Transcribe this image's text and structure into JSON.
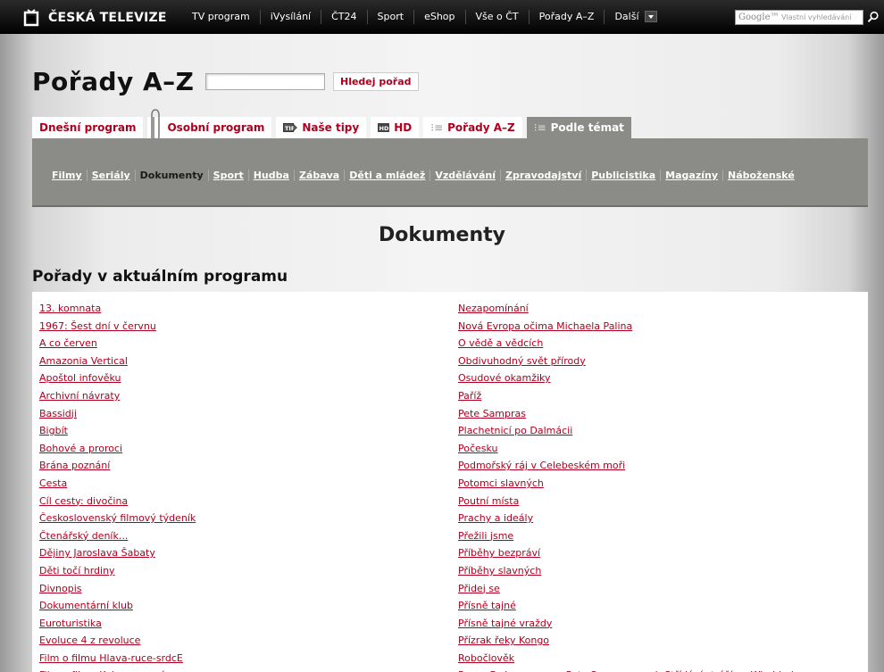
{
  "header": {
    "logo_text": "ČESKÁ TELEVIZE",
    "nav": [
      "TV program",
      "iVysílání",
      "ČT24",
      "Sport",
      "eShop",
      "Vše o ČT",
      "Pořady A–Z",
      "Další"
    ],
    "search_brand": "Google™",
    "search_placeholder": "Vlastní vyhledávání"
  },
  "page": {
    "title": "Pořady A–Z",
    "find_button": "Hledej pořad",
    "tabs": [
      {
        "label": "Dnešní program",
        "icon": ""
      },
      {
        "label": "Osobní program",
        "icon": "paperclip-icon"
      },
      {
        "label": "Naše tipy",
        "icon": "tip-icon"
      },
      {
        "label": "HD",
        "icon": "hd-icon"
      },
      {
        "label": "Pořady A–Z",
        "icon": "list-icon"
      },
      {
        "label": "Podle témat",
        "icon": "list-icon"
      }
    ],
    "subnav": [
      "Filmy",
      "Seriály",
      "Dokumenty",
      "Sport",
      "Hudba",
      "Zábava",
      "Děti a mládež",
      "Vzdělávání",
      "Zpravodajství",
      "Publicistika",
      "Magazíny",
      "Náboženské"
    ],
    "section_title": "Dokumenty",
    "list_heading": "Pořady v aktuálním programu",
    "left_items": [
      "13. komnata",
      "1967: Šest dní v červnu",
      "A co červen",
      "Amazonia Vertical",
      "Apoštol infověku",
      "Archivní návraty",
      "Bassidji",
      "Bigbít",
      "Bohové a proroci",
      "Brána poznání",
      "Cesta",
      "Cíl cesty: divočina",
      "Československý filmový týdeník",
      "Čtenářský deník...",
      "Dějiny Jaroslava Šabaty",
      "Děti točí hrdiny",
      "Divnopis",
      "Dokumentární klub",
      "Euroturistika",
      "Evoluce 4 z revoluce",
      "Film o filmu Hlava-ruce-srdcE",
      "Film o filmu Kuky se vrací"
    ],
    "right_items": [
      "Nezapomínání",
      "Nová Evropa očima Michaela Palina",
      "O vědě a vědcích",
      "Obdivuhodný svět přírody",
      "Osudové okamžiky",
      "Paříž",
      "Pete Sampras",
      "Plachetnicí po Dalmácii",
      "Počesku",
      "Podmořský ráj v Celebeském moři",
      "Potomci slavných",
      "Poutní místa",
      "Prachy a ideály",
      "Přežili jsme",
      "Příběhy bezpráví",
      "Příběhy slavných",
      "Přidej se",
      "Přísně tajné",
      "Přísně tajné vraždy",
      "Přízrak řeky Kongo",
      "Robočlověk",
      "Roger Federer versus Pete Sampras aneb Střídání stráží ve Wimbledonu"
    ]
  },
  "colors": {
    "accent": "#b0001e",
    "tab_active": "#8b8b87",
    "topbar": "#000000"
  }
}
